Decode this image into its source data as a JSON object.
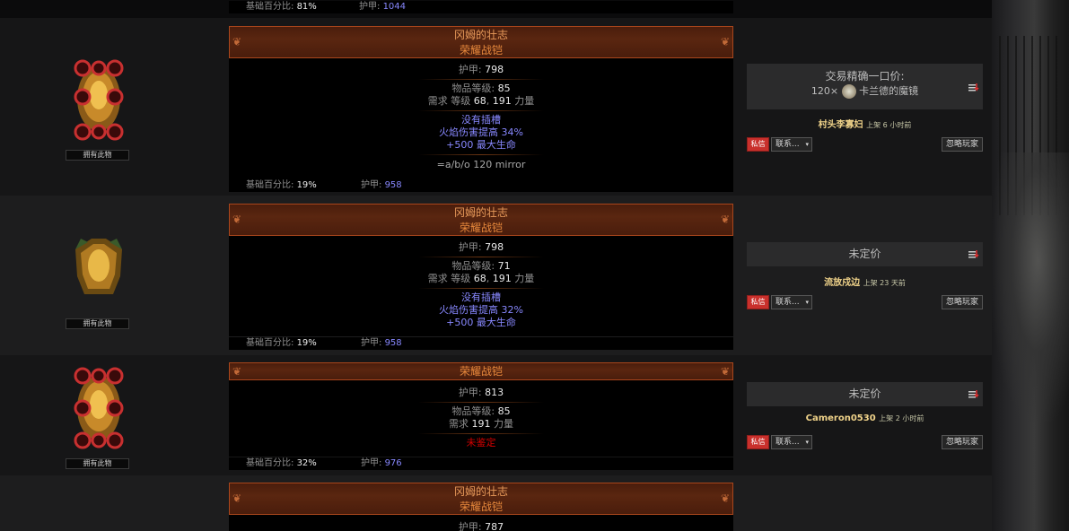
{
  "top_footer": {
    "base_pct_label": "基础百分比:",
    "base_pct": "81%",
    "armour_label": "护甲:",
    "armour": "1044"
  },
  "listings": [
    {
      "name": "冈姆的壮志",
      "base": "荣耀战铠",
      "armour_label": "护甲:",
      "armour": "798",
      "ilvl_label": "物品等级:",
      "ilvl": "85",
      "req_label": "需求 等级",
      "req_level": "68",
      "req_str": "191",
      "req_str_label": "力量",
      "mods": [
        "没有插槽",
        "火焰伤害提高 34%",
        "+500 最大生命"
      ],
      "note": "=a/b/o 120 mirror",
      "base_pct_label": "基础百分比:",
      "base_pct": "19%",
      "armour_foot_label": "护甲:",
      "armour_foot": "958",
      "owned": "拥有此物",
      "price_title": "交易精确一口价:",
      "price_amount": "120×",
      "price_currency": "卡兰德的魔镜",
      "seller": "村头李寡妇",
      "listed": "上架 6 小时前",
      "whisper": "私信",
      "contact": "联系...",
      "ignore": "忽略玩家"
    },
    {
      "name": "冈姆的壮志",
      "base": "荣耀战铠",
      "armour_label": "护甲:",
      "armour": "798",
      "ilvl_label": "物品等级:",
      "ilvl": "71",
      "req_label": "需求 等级",
      "req_level": "68",
      "req_str": "191",
      "req_str_label": "力量",
      "mods": [
        "没有插槽",
        "火焰伤害提高 32%",
        "+500 最大生命"
      ],
      "base_pct_label": "基础百分比:",
      "base_pct": "19%",
      "armour_foot_label": "护甲:",
      "armour_foot": "958",
      "owned": "拥有此物",
      "price_title": "未定价",
      "seller": "流放戍边",
      "listed": "上架 23 天前",
      "whisper": "私信",
      "contact": "联系...",
      "ignore": "忽略玩家"
    },
    {
      "base": "荣耀战铠",
      "armour_label": "护甲:",
      "armour": "813",
      "ilvl_label": "物品等级:",
      "ilvl": "85",
      "req_label": "需求",
      "req_str": "191",
      "req_str_label": "力量",
      "unidentified": "未鉴定",
      "base_pct_label": "基础百分比:",
      "base_pct": "32%",
      "armour_foot_label": "护甲:",
      "armour_foot": "976",
      "owned": "拥有此物",
      "price_title": "未定价",
      "seller": "Cameron0530",
      "listed": "上架 2 小时前",
      "whisper": "私信",
      "contact": "联系...",
      "ignore": "忽略玩家"
    },
    {
      "name": "冈姆的壮志",
      "base": "荣耀战铠",
      "armour_label": "护甲:",
      "armour": "787"
    }
  ],
  "colors": {
    "unique": "#e8893c",
    "magic": "#8888ff",
    "unid": "#d20000",
    "seller": "#f0d38a"
  }
}
